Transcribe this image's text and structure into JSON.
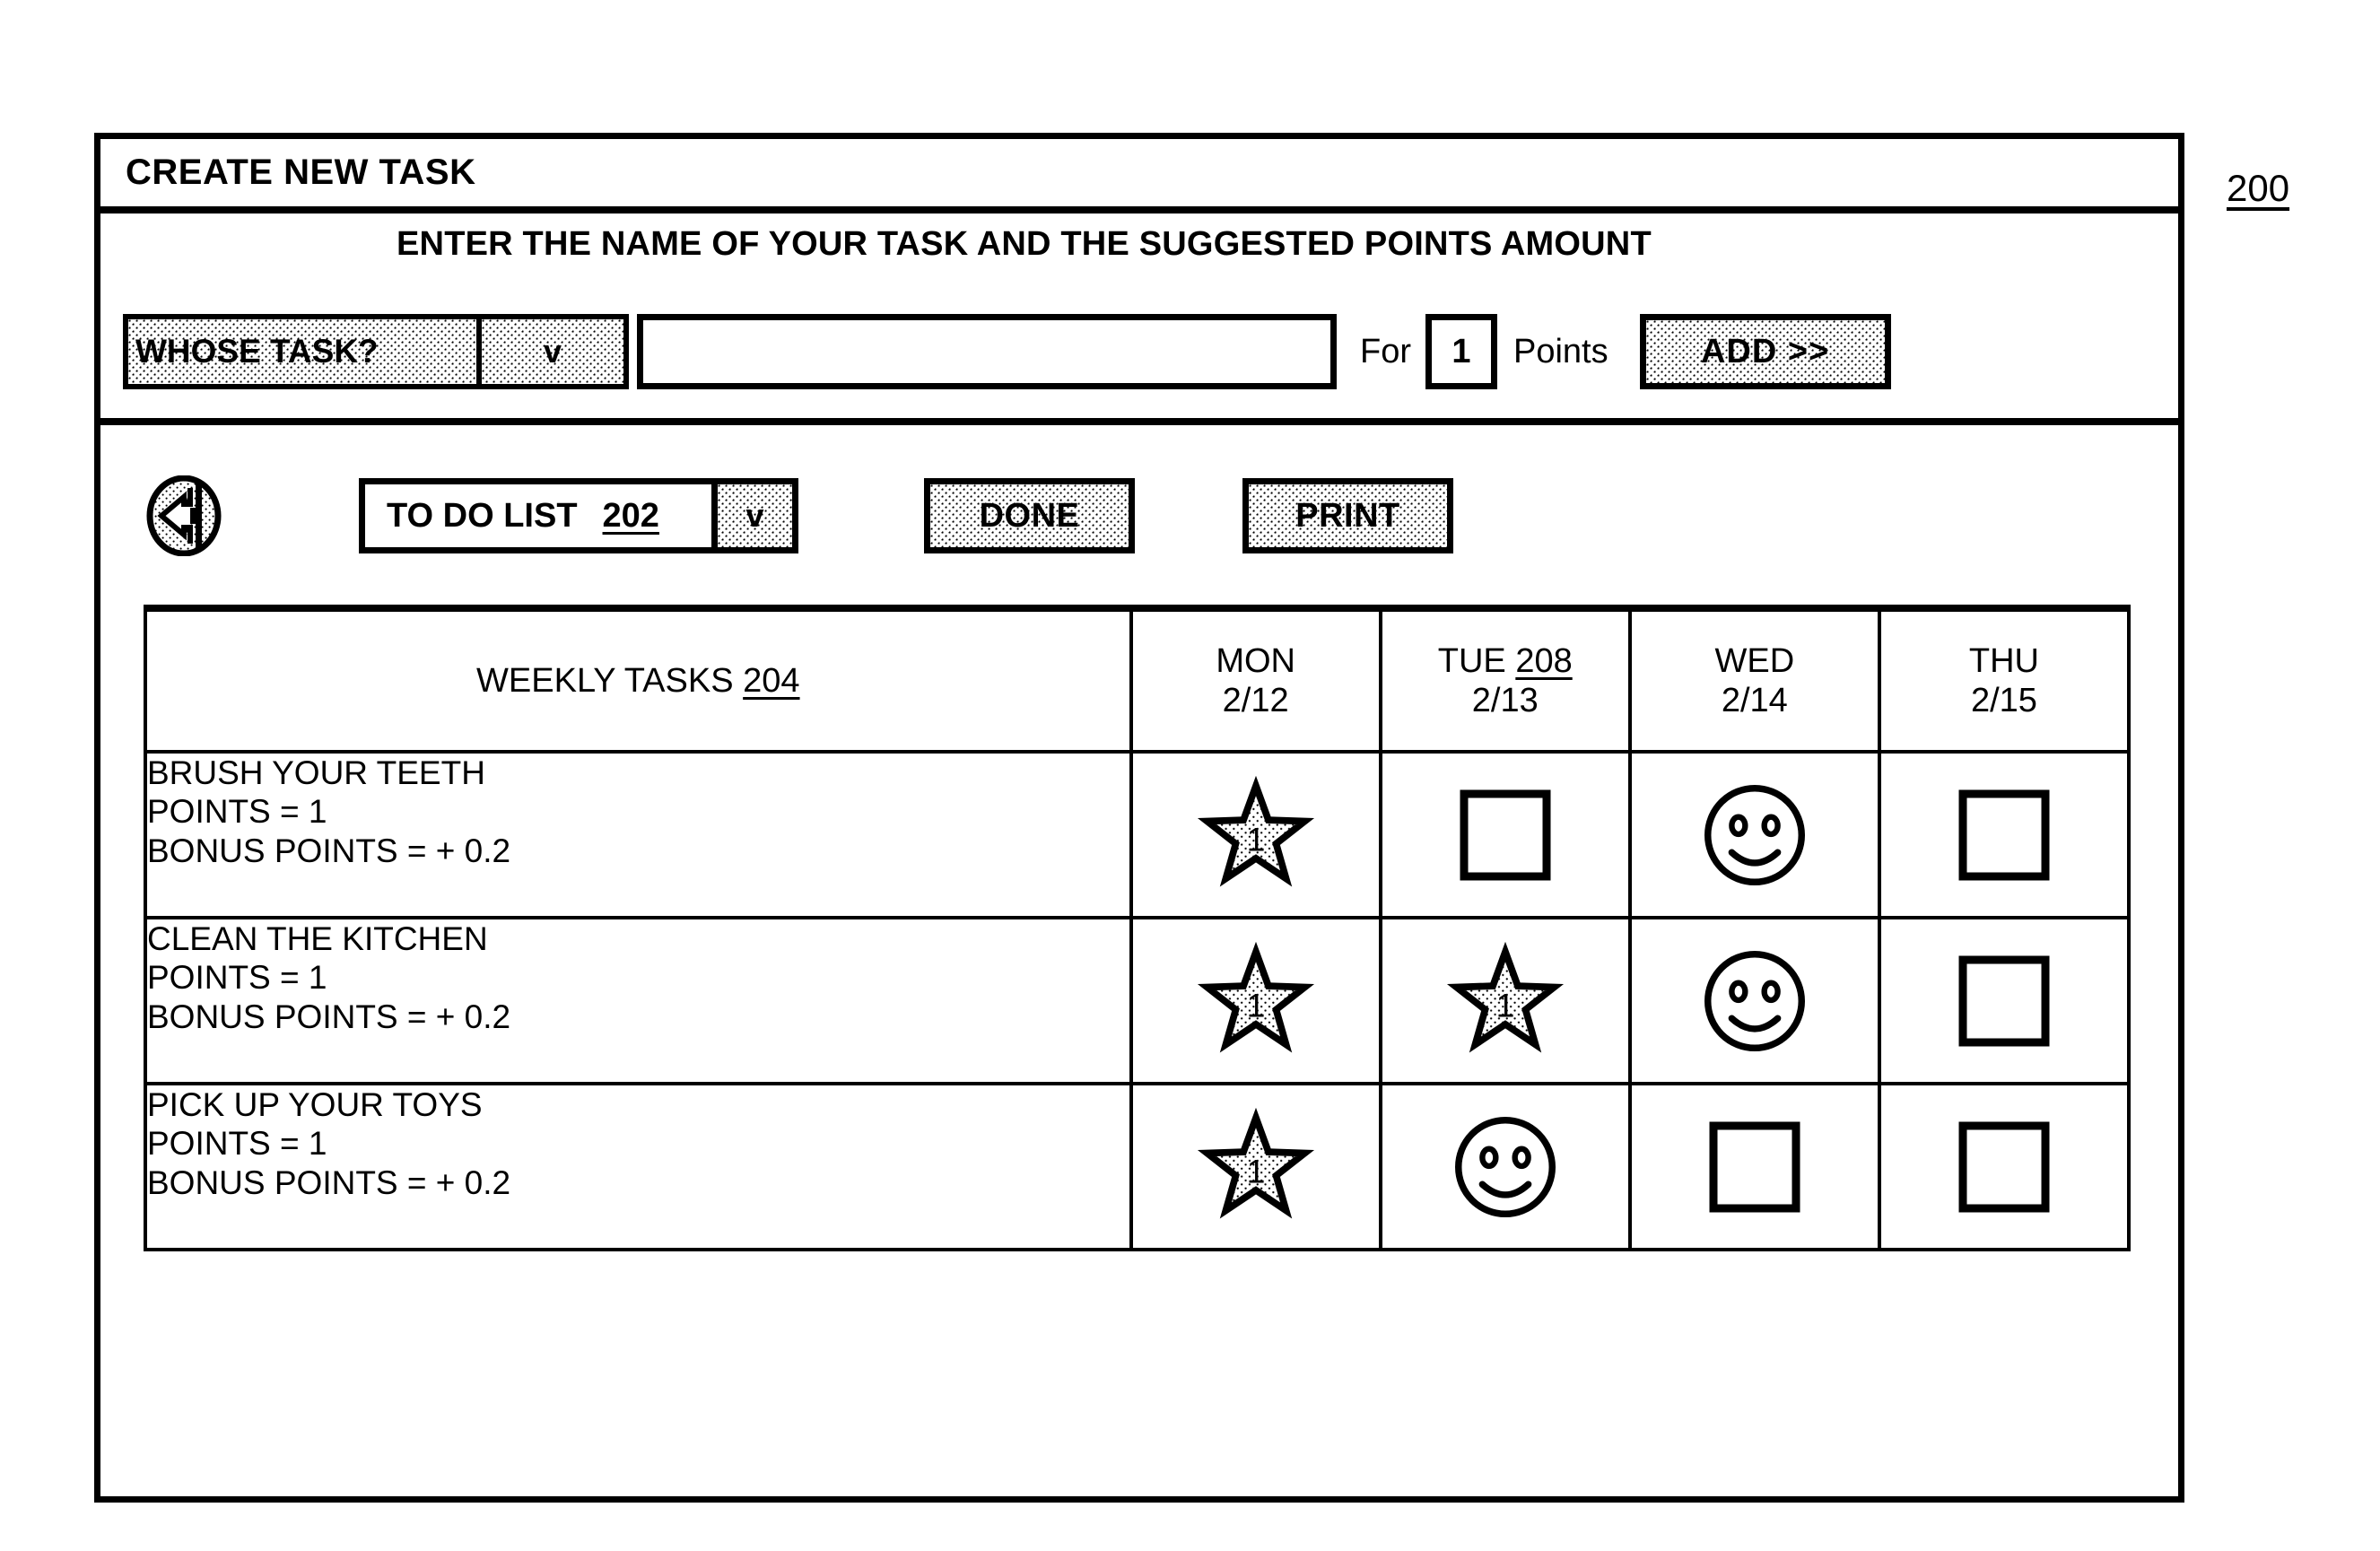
{
  "figure_reference": "200",
  "window": {
    "title": "CREATE NEW TASK"
  },
  "create_panel": {
    "instruction": "ENTER THE NAME OF YOUR TASK AND THE SUGGESTED POINTS AMOUNT",
    "whose_task_label": "WHOSE TASK?",
    "whose_task_caret": "v",
    "task_name_value": "",
    "task_name_placeholder": "",
    "for_label": "For",
    "points_value": "1",
    "points_label": "Points",
    "add_button_label": "ADD >>"
  },
  "toolbar": {
    "back_icon": "back-arrow-icon",
    "list_select_label": "TO DO LIST",
    "list_select_ref": "202",
    "list_select_caret": "v",
    "done_label": "DONE",
    "print_label": "PRINT"
  },
  "table": {
    "tasks_header": "WEEKLY TASKS",
    "tasks_header_ref": "204",
    "day_columns": [
      {
        "day": "MON",
        "date": "2/12",
        "ref": ""
      },
      {
        "day": "TUE",
        "date": "2/13",
        "ref": "208"
      },
      {
        "day": "WED",
        "date": "2/14",
        "ref": ""
      },
      {
        "day": "THU",
        "date": "2/15",
        "ref": ""
      }
    ],
    "rows": [
      {
        "name": "BRUSH YOUR TEETH",
        "points": "POINTS = 1",
        "bonus": "BONUS POINTS = + 0.2",
        "marks": [
          "star",
          "box",
          "smiley",
          "box"
        ],
        "star_value": "1"
      },
      {
        "name": "CLEAN THE KITCHEN",
        "points": "POINTS = 1",
        "bonus": "BONUS POINTS = + 0.2",
        "marks": [
          "star",
          "star",
          "smiley",
          "box"
        ],
        "star_value": "1"
      },
      {
        "name": "PICK UP YOUR TOYS",
        "points": "POINTS = 1",
        "bonus": "BONUS POINTS = + 0.2",
        "marks": [
          "star",
          "smiley",
          "box",
          "box"
        ],
        "star_value": "1"
      }
    ]
  }
}
